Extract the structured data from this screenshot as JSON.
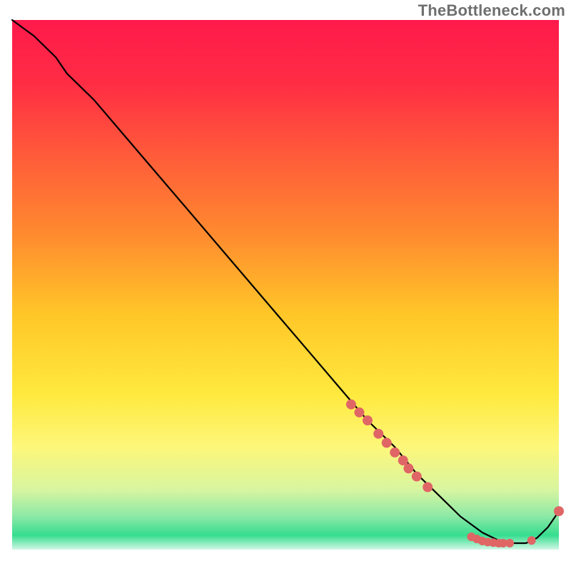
{
  "watermark": "TheBottleneck.com",
  "chart_data": {
    "type": "line",
    "title": "",
    "xlabel": "",
    "ylabel": "",
    "xlim": [
      0,
      100
    ],
    "ylim": [
      0,
      100
    ],
    "grid": false,
    "background": {
      "type": "vertical-gradient",
      "stops": [
        {
          "offset": 0.0,
          "color": "#ff1a4b"
        },
        {
          "offset": 0.12,
          "color": "#ff2d44"
        },
        {
          "offset": 0.25,
          "color": "#ff5a3a"
        },
        {
          "offset": 0.4,
          "color": "#ff8a2f"
        },
        {
          "offset": 0.55,
          "color": "#ffc628"
        },
        {
          "offset": 0.7,
          "color": "#ffe93e"
        },
        {
          "offset": 0.8,
          "color": "#fdf77a"
        },
        {
          "offset": 0.88,
          "color": "#d8f5a0"
        },
        {
          "offset": 0.93,
          "color": "#8be9a6"
        },
        {
          "offset": 0.965,
          "color": "#36dd8f"
        },
        {
          "offset": 1.0,
          "color": "#ffffff"
        }
      ]
    },
    "series": [
      {
        "name": "bottleneck-curve",
        "type": "line",
        "color": "#000000",
        "x": [
          0,
          4,
          8,
          10,
          15,
          20,
          25,
          30,
          35,
          40,
          45,
          50,
          55,
          60,
          65,
          70,
          74,
          78,
          82,
          86,
          90,
          94,
          96,
          98,
          100
        ],
        "y": [
          100,
          97,
          93,
          90,
          85,
          79,
          73,
          67,
          61,
          55,
          49,
          43,
          37,
          31,
          25,
          20,
          15,
          11,
          7,
          4,
          2,
          2,
          3,
          5,
          8
        ]
      },
      {
        "name": "highlight-points-upper",
        "type": "scatter",
        "color": "#e06666",
        "radius": 7,
        "x": [
          62,
          63.5,
          65,
          67,
          68.5,
          70,
          71.5,
          72.5,
          74,
          76
        ],
        "y": [
          28,
          26.5,
          25,
          22.5,
          20.8,
          19,
          17.5,
          16,
          14.5,
          12.5
        ]
      },
      {
        "name": "highlight-points-lower",
        "type": "scatter",
        "color": "#e06666",
        "radius": 6,
        "x": [
          84,
          85,
          86,
          87,
          88,
          89,
          89.8,
          91,
          95
        ],
        "y": [
          3.2,
          2.8,
          2.4,
          2.2,
          2.1,
          2.0,
          2.0,
          2.0,
          2.5
        ]
      },
      {
        "name": "highlight-point-end",
        "type": "scatter",
        "color": "#e06666",
        "radius": 7,
        "x": [
          100
        ],
        "y": [
          8
        ]
      }
    ]
  }
}
